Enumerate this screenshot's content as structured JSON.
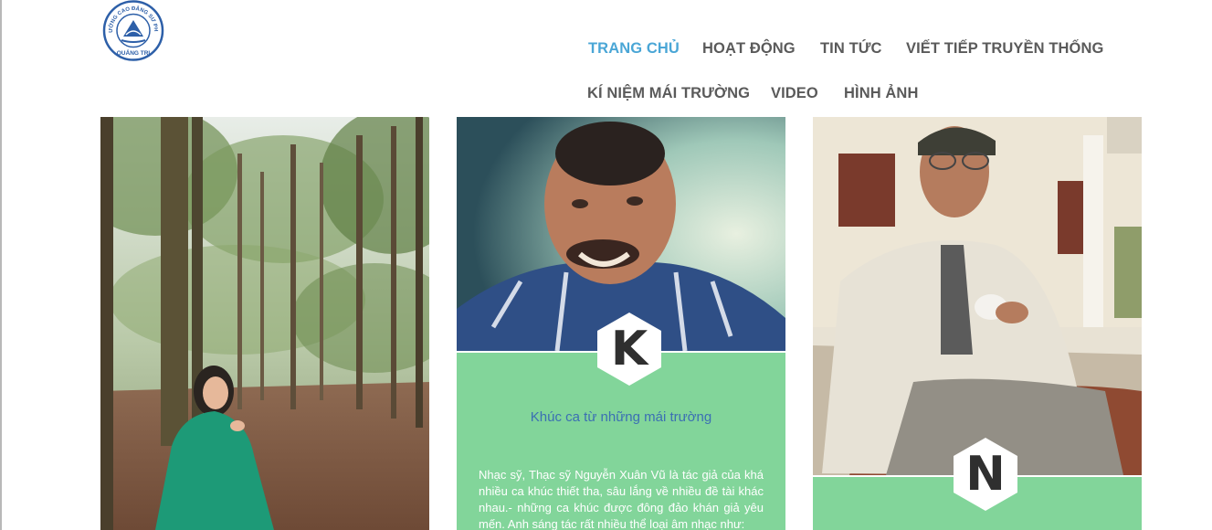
{
  "logo": {
    "top_text": "TRƯỜNG CAO ĐẲNG SƯ PHẠM",
    "bottom_text": "QUẢNG TRỊ"
  },
  "nav": {
    "items": [
      {
        "label": "TRANG CHỦ",
        "active": true
      },
      {
        "label": "HOẠT ĐỘNG",
        "active": false
      },
      {
        "label": "TIN TỨC",
        "active": false
      },
      {
        "label": "VIẾT TIẾP TRUYỀN THỐNG",
        "active": false
      },
      {
        "label": "KÍ NIỆM MÁI TRƯỜNG",
        "active": false
      },
      {
        "label": "VIDEO",
        "active": false
      },
      {
        "label": "HÌNH ẢNH",
        "active": false
      }
    ],
    "active_color": "#4aa6d6",
    "color": "#5a5a5a"
  },
  "cards": [
    {
      "image": "woman-in-forest-photo"
    },
    {
      "image": "smiling-man-portrait-photo",
      "initial": "K",
      "title": "Khúc ca từ những mái trường",
      "excerpt": "Nhạc sỹ, Thạc sỹ Nguyễn Xuân Vũ là tác giả của khá nhiều ca khúc thiết tha, sâu lắng về nhiều đề tài khác nhau.- những ca khúc được đông đảo khán giả yêu mến. Anh sáng tác rất nhiều thể loại âm nhạc như:"
    },
    {
      "image": "man-with-cup-photo",
      "initial": "N"
    }
  ],
  "colors": {
    "card_green": "#82d59a",
    "title_blue": "#3b6fb3"
  }
}
